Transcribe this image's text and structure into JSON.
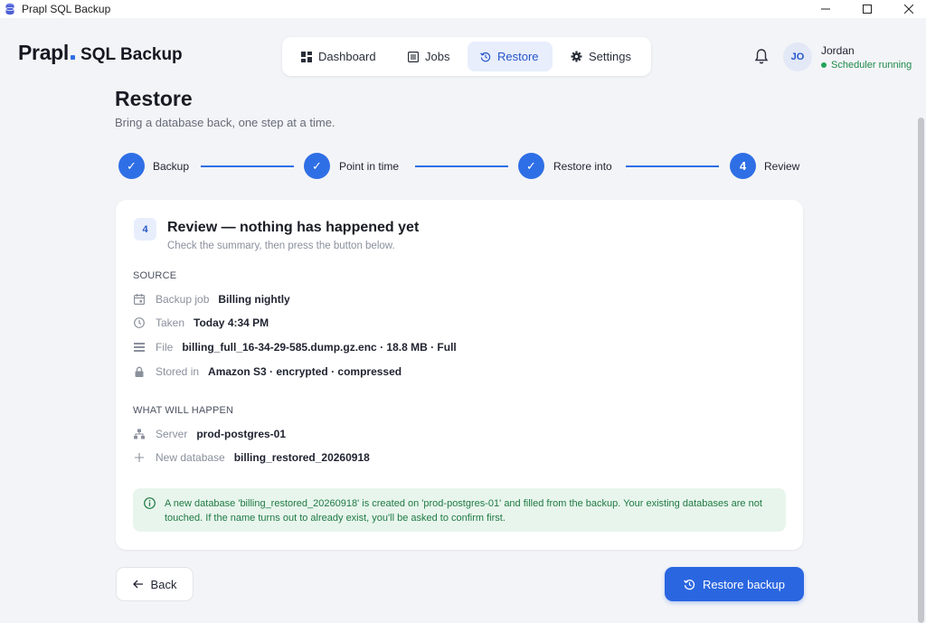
{
  "window": {
    "title": "Prapl SQL Backup"
  },
  "header": {
    "brand": "Prapl",
    "product": "SQL Backup",
    "nav": [
      {
        "label": "Dashboard"
      },
      {
        "label": "Jobs"
      },
      {
        "label": "Restore",
        "active": true
      },
      {
        "label": "Settings"
      }
    ],
    "user": {
      "initials": "JO",
      "name": "Jordan",
      "status": "Scheduler running"
    }
  },
  "page": {
    "title": "Restore",
    "subtitle": "Bring a database back, one step at a time."
  },
  "stepper": {
    "steps": [
      {
        "marker": "✓",
        "label": "Backup",
        "state": "done"
      },
      {
        "marker": "✓",
        "label": "Point in time",
        "state": "done"
      },
      {
        "marker": "✓",
        "label": "Restore into",
        "state": "done"
      },
      {
        "marker": "4",
        "label": "Review",
        "state": "current"
      }
    ]
  },
  "review": {
    "step_number": "4",
    "title": "Review — nothing has happened yet",
    "subtitle": "Check the summary, then press the button below.",
    "source": {
      "heading": "SOURCE",
      "rows": [
        {
          "icon": "calendar-icon",
          "label": "Backup job",
          "value": "Billing nightly"
        },
        {
          "icon": "clock-icon",
          "label": "Taken",
          "value": "Today 4:34 PM"
        },
        {
          "icon": "file-list-icon",
          "label": "File",
          "value": "billing_full_16-34-29-585.dump.gz.enc · 18.8 MB · Full"
        },
        {
          "icon": "lock-icon",
          "label": "Stored in",
          "value": "Amazon S3 · encrypted · compressed"
        }
      ]
    },
    "outcome": {
      "heading": "WHAT WILL HAPPEN",
      "rows": [
        {
          "icon": "server-icon",
          "label": "Server",
          "value": "prod-postgres-01"
        },
        {
          "icon": "plus-icon",
          "label": "New database",
          "value": "billing_restored_20260918"
        }
      ]
    },
    "notice": "A new database 'billing_restored_20260918' is created on 'prod-postgres-01' and filled from the backup. Your existing databases are not touched. If the name turns out to already exist, you'll be asked to confirm first."
  },
  "actions": {
    "back_label": "Back",
    "restore_label": "Restore backup"
  },
  "colors": {
    "accent": "#2f6fe6",
    "success": "#1f8a4c",
    "notice_bg": "#e8f5ec"
  }
}
